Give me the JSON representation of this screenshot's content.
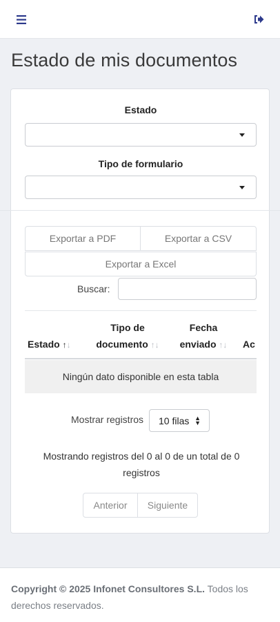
{
  "header": {
    "menu_icon": "hamburger-menu-icon",
    "logout_icon": "sign-out-icon",
    "accent": "#2d3a8c"
  },
  "page": {
    "title": "Estado de mis documentos"
  },
  "filters": {
    "estado_label": "Estado",
    "estado_value": "",
    "tipo_label": "Tipo de formulario",
    "tipo_value": ""
  },
  "export": {
    "pdf": "Exportar a PDF",
    "csv": "Exportar a CSV",
    "excel": "Exportar a Excel"
  },
  "search": {
    "label": "Buscar:",
    "value": ""
  },
  "table": {
    "columns": [
      {
        "line1": "",
        "line2": "Estado",
        "sort": "asc"
      },
      {
        "line1": "Tipo de",
        "line2": "documento",
        "sort": "none"
      },
      {
        "line1": "Fecha",
        "line2": "enviado",
        "sort": "none"
      },
      {
        "line1": "",
        "line2": "Ac",
        "sort": "none"
      }
    ],
    "empty_message": "Ningún dato disponible en esta tabla"
  },
  "length": {
    "label": "Mostrar registros",
    "value": "10 filas"
  },
  "info": "Mostrando registros del 0 al 0 de un total de 0 registros",
  "pagination": {
    "prev": "Anterior",
    "next": "Siguiente"
  },
  "footer": {
    "copyright": "Copyright © 2025 Infonet Consultores S.L.",
    "rights": "Todos los derechos reservados."
  }
}
